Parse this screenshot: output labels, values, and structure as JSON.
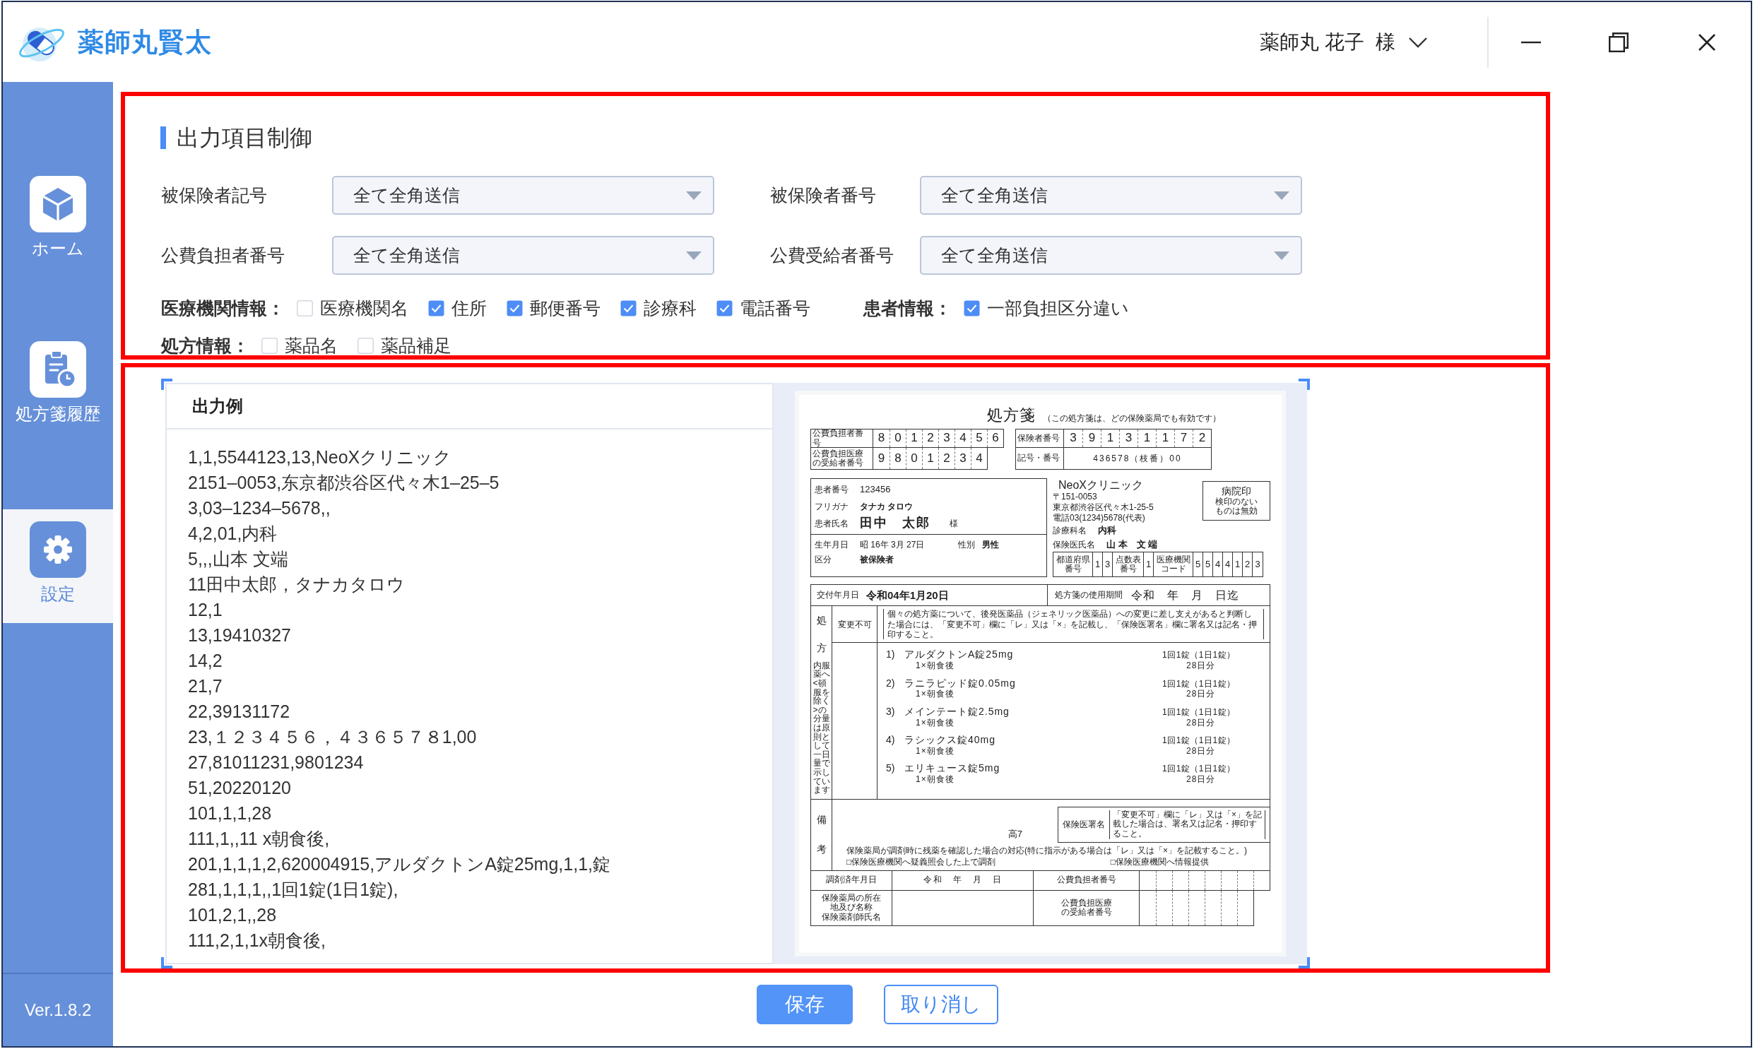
{
  "window": {
    "title": "薬師丸賢太",
    "user_name": "薬師丸 花子",
    "honorific": "様"
  },
  "sidebar": {
    "items": [
      {
        "kind": "home",
        "label": "ホーム",
        "selected": false
      },
      {
        "kind": "history",
        "label": "処方箋履歴",
        "selected": false
      },
      {
        "kind": "settings",
        "label": "設定",
        "selected": true
      }
    ],
    "version": "Ver.1.8.2"
  },
  "output_control": {
    "highlighted": true,
    "title": "出力項目制御",
    "selects": [
      {
        "label": "被保険者記号",
        "value": "全て全角送信"
      },
      {
        "label": "被保険者番号",
        "value": "全て全角送信"
      },
      {
        "label": "公費負担者番号",
        "value": "全て全角送信"
      },
      {
        "label": "公費受給者番号",
        "value": "全て全角送信"
      }
    ],
    "check_rows": [
      {
        "groups": [
          {
            "label": "医療機関情報：",
            "options": [
              {
                "label": "医療機関名",
                "checked": false
              },
              {
                "label": "住所",
                "checked": true
              },
              {
                "label": "郵便番号",
                "checked": true
              },
              {
                "label": "診療科",
                "checked": true
              },
              {
                "label": "電話番号",
                "checked": true
              }
            ]
          },
          {
            "label": "患者情報：",
            "options": [
              {
                "label": "一部負担区分違い",
                "checked": true
              }
            ]
          }
        ]
      },
      {
        "groups": [
          {
            "label": "処方情報：",
            "options": [
              {
                "label": "薬品名",
                "checked": false
              },
              {
                "label": "薬品補足",
                "checked": false
              }
            ]
          }
        ]
      }
    ]
  },
  "output_preview": {
    "highlighted": true,
    "title": "出力例",
    "lines": [
      "1,1,5544123,13,NeoXクリニック",
      "2151–0053,东京都渋谷区代々木1–25–5",
      "3,03–1234–5678,,",
      "4,2,01,内科",
      "5,,,山本 文端",
      "11田中太郎，タナカタロウ",
      "12,1",
      "13,19410327",
      "14,2",
      "21,7",
      "22,39131172",
      "23,１２３４５６，４３６５７８1,00",
      "27,81011231,9801234",
      "51,20220120",
      "101,1,1,28",
      "111,1,,11 x朝食後,",
      "201,1,1,1,2,620004915,アルダクトンA錠25mg,1,1,錠",
      "281,1,1,1,,1回1錠(1日1錠),",
      "101,2,1,,28",
      "111,2,1,1x朝食後,"
    ],
    "document": {
      "title": "処方箋",
      "note": "（この処方箋は、どの保険薬局でも有効です）",
      "public_payer": {
        "label": "公費負担者番号",
        "digits": [
          "8",
          "0",
          "1",
          "2",
          "3",
          "4",
          "5",
          "6"
        ]
      },
      "public_recipient": {
        "label": "公費負担医療の受給者番号",
        "digits": [
          "9",
          "8",
          "0",
          "1",
          "2",
          "3",
          "4"
        ]
      },
      "insurer": {
        "label": "保険者番号",
        "digits": [
          "3",
          "9",
          "1",
          "3",
          "1",
          "1",
          "7",
          "2"
        ]
      },
      "symbol_number": {
        "label": "記号・番号",
        "value": "436578（枝番）00"
      },
      "patient": {
        "rows": [
          {
            "kind": "number",
            "label": "患者番号",
            "value": "123456"
          },
          {
            "kind": "kana",
            "label": "フリガナ",
            "value": "タナカ タロウ"
          },
          {
            "kind": "name",
            "label": "患者氏名",
            "value": "田中　太郎",
            "suffix": "様"
          }
        ],
        "birth": {
          "label": "生年月日",
          "value": "昭 16年 3月 27日"
        },
        "sex": {
          "label": "性別",
          "value": "男性"
        },
        "category": {
          "label": "区分",
          "value": "被保険者"
        }
      },
      "clinic": {
        "name": "NeoXクリニック",
        "postal": "〒151-0053",
        "address": "東京都渋谷区代々木1-25-5",
        "phone": "電話03(1234)5678(代表)",
        "department": {
          "label": "診療科名",
          "value": "内科"
        },
        "doctor": {
          "label": "保険医氏名",
          "value": "山 本　文 端"
        },
        "stamp": {
          "title": "病院印",
          "note": "検印のないものは無効"
        },
        "codes": [
          {
            "label": "都道府県番号",
            "digits": [
              "1",
              "3"
            ]
          },
          {
            "label": "点数表番号",
            "digits": [
              "1"
            ]
          },
          {
            "label": "医療機関コード",
            "digits": [
              "5",
              "5",
              "4",
              "4",
              "1",
              "2",
              "3"
            ]
          }
        ]
      },
      "issue": {
        "label": "交付年月日",
        "value": "令和04年1月20日"
      },
      "period": {
        "label": "処方箋の使用期間",
        "value": "令和　年　月　日迄"
      },
      "rx": {
        "label_top": "処",
        "label_bottom": "方",
        "side_note": "内服薬へ<頓服を除く>の分量は原則として一日量で示しています",
        "no_change_label": "変更不可",
        "no_change_note": "個々の処方薬について、後発医薬品（ジェネリック医薬品）への変更に差し支えがあると判断した場合には、「変更不可」欄に「レ」又は「×」を記載し、「保険医署名」欄に署名又は記名・押印すること。",
        "drugs": [
          {
            "number": "1)",
            "name": "アルダクトンA錠25mg",
            "usage": "1×朝食後",
            "dose": "1回1錠（1日1錠）",
            "days": "28日分"
          },
          {
            "number": "2)",
            "name": "ラニラピッド錠0.05mg",
            "usage": "1×朝食後",
            "dose": "1回1錠（1日1錠）",
            "days": "28日分"
          },
          {
            "number": "3)",
            "name": "メインテート錠2.5mg",
            "usage": "1×朝食後",
            "dose": "1回1錠（1日1錠）",
            "days": "28日分"
          },
          {
            "number": "4)",
            "name": "ラシックス錠40mg",
            "usage": "1×朝食後",
            "dose": "1回1錠（1日1錠）",
            "days": "28日分"
          },
          {
            "number": "5)",
            "name": "エリキュース錠5mg",
            "usage": "1×朝食後",
            "dose": "1回1錠（1日1錠）",
            "days": "28日分"
          }
        ]
      },
      "remarks": {
        "label_top": "備",
        "label_bottom": "考",
        "text": "高7",
        "signature": {
          "label": "保険医署名",
          "note": "「変更不可」欄に「レ」又は「×」を記載した場合は、署名又は記名・押印すること。"
        },
        "leftover_note": "保険薬局が調剤時に残薬を確認した場合の対応(特に指示がある場合は「レ」又は「×」を記載すること。)",
        "leftover_options": [
          "□保険医療機関へ疑義照会した上で調剤",
          "□保険医療機関へ情報提供"
        ]
      },
      "dispensing": {
        "date_label": "調剤済年月日",
        "date_value": "令和　年　月　日",
        "payer_label": "公費負担者番号",
        "pharmacy_labels": [
          "保険薬局の所在地及び名称",
          "保険薬剤師氏名"
        ],
        "recipient_label": "公費負担医療の受給者番号"
      }
    }
  },
  "buttons": [
    {
      "kind": "primary",
      "label": "保存"
    },
    {
      "kind": "secondary",
      "label": "取り消し"
    }
  ]
}
